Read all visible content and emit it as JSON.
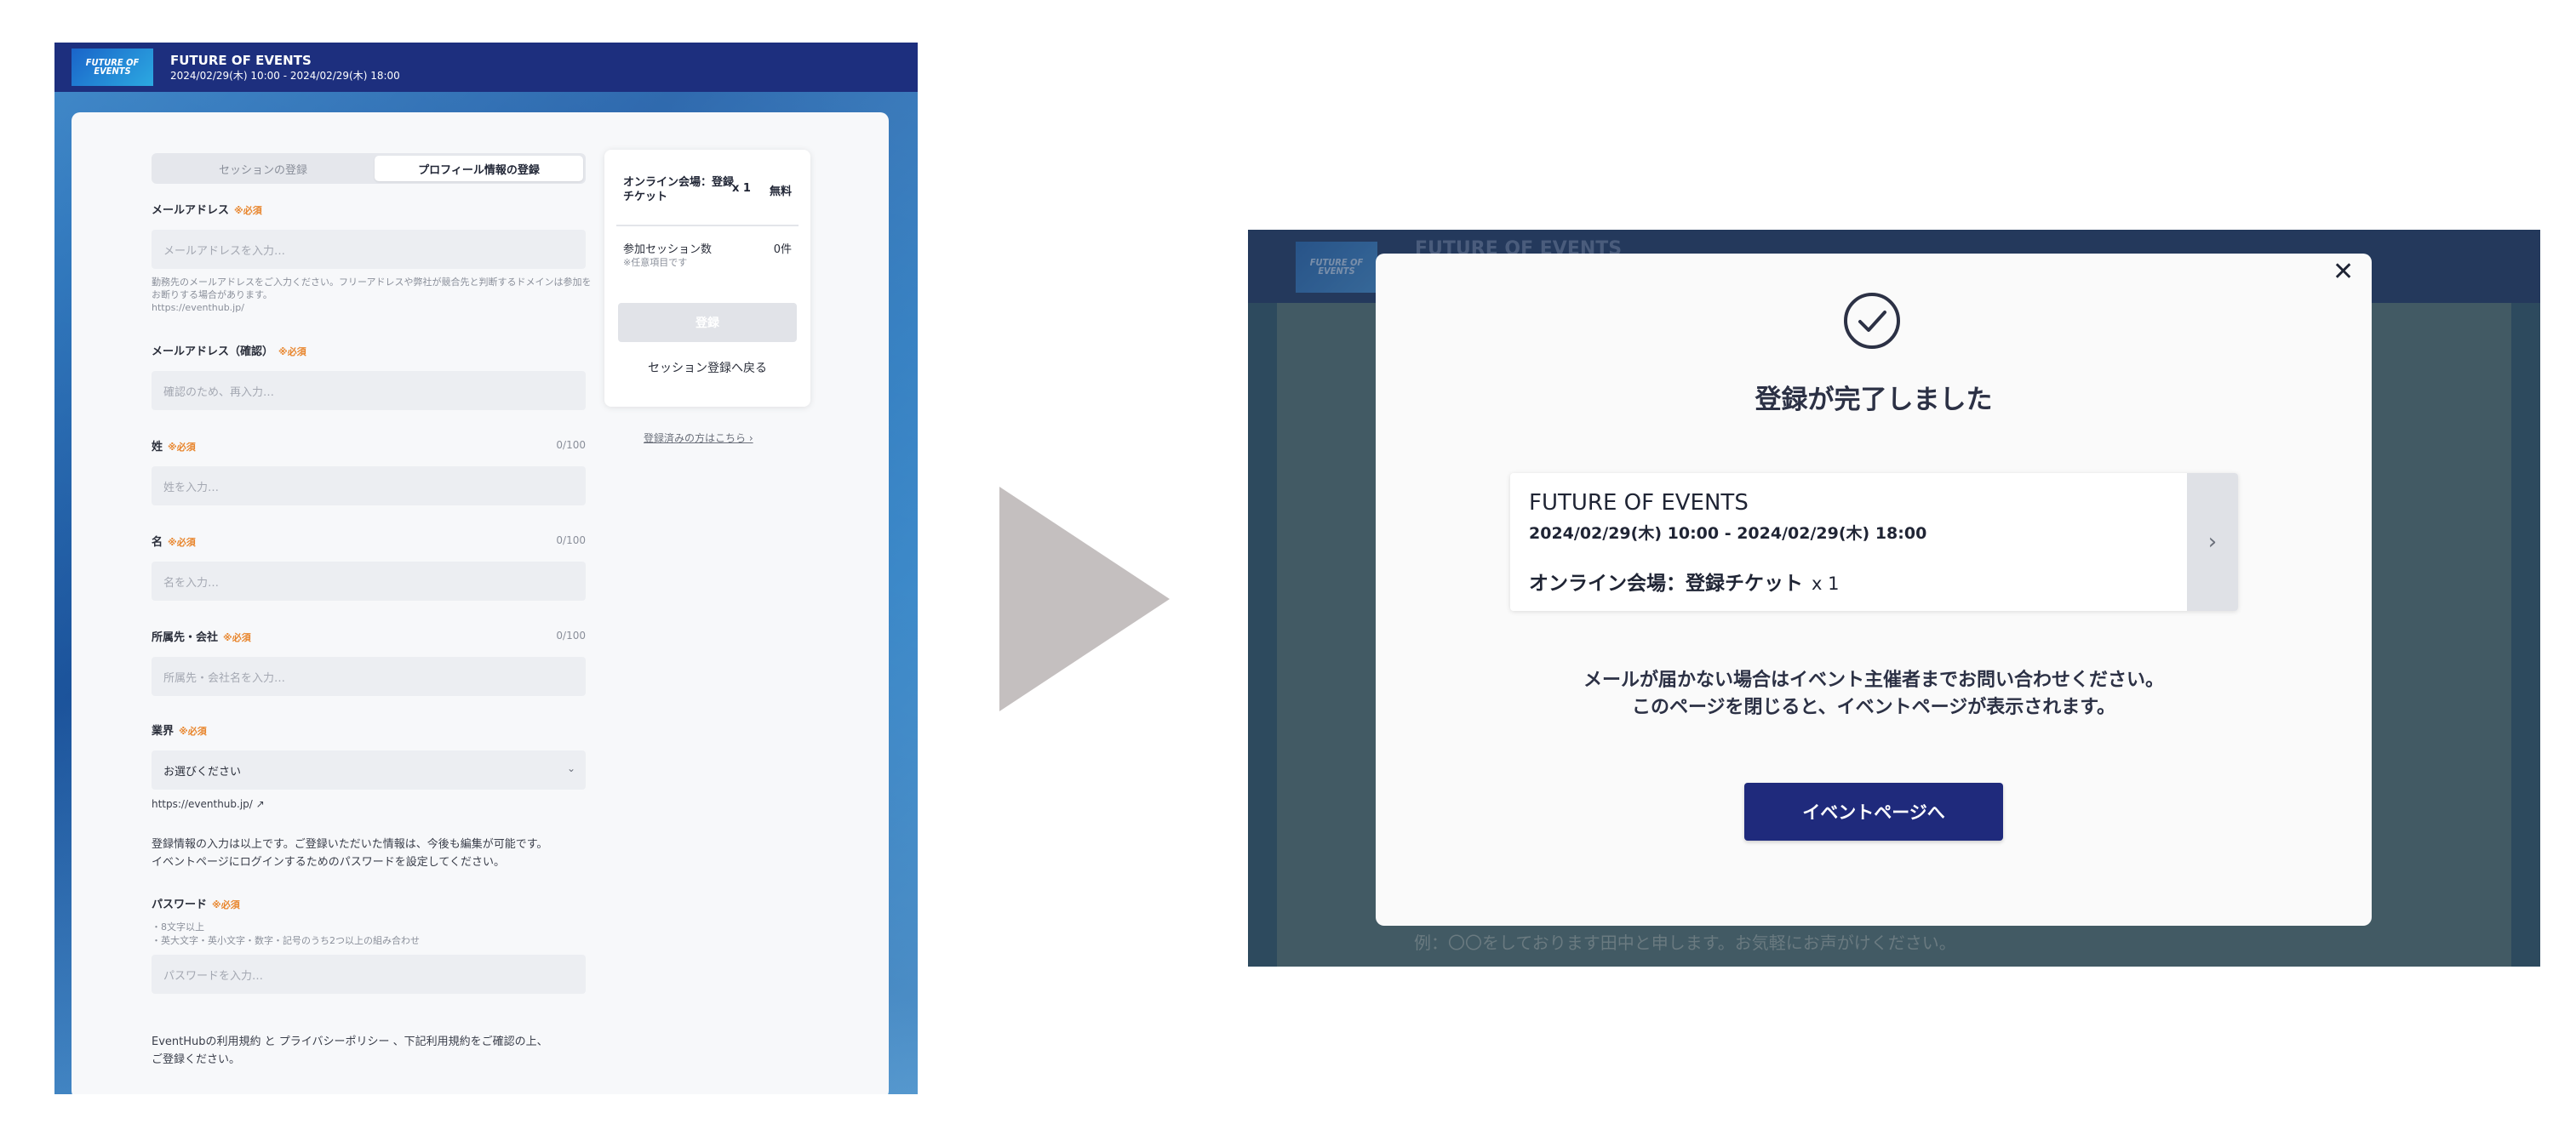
{
  "left": {
    "header": {
      "logo_text": "FUTURE OF EVENTS",
      "event_name": "FUTURE OF EVENTS",
      "event_date": "2024/02/29(木) 10:00 - 2024/02/29(木) 18:00"
    },
    "steps": [
      "セッションの登録",
      "プロフィール情報の登録"
    ],
    "required_mark": "※必須",
    "fields": {
      "email": {
        "label": "メールアドレス",
        "placeholder": "メールアドレスを入力…",
        "note": "勤務先のメールアドレスをご入力ください。フリーアドレスや弊社が競合先と判断するドメインは参加をお断りする場合があります。",
        "note_url": "https://eventhub.jp/"
      },
      "email_confirm": {
        "label": "メールアドレス（確認）",
        "placeholder": "確認のため、再入力…"
      },
      "last_name": {
        "label": "姓",
        "count": "0/100",
        "placeholder": "姓を入力…"
      },
      "first_name": {
        "label": "名",
        "count": "0/100",
        "placeholder": "名を入力…"
      },
      "company": {
        "label": "所属先・会社",
        "count": "0/100",
        "placeholder": "所属先・会社名を入力…"
      },
      "industry": {
        "label": "業界",
        "selected": "お選びください",
        "arrow": "⌄"
      },
      "link": "https://eventhub.jp/",
      "info_text_1": "登録情報の入力は以上です。ご登録いただいた情報は、今後も編集が可能です。",
      "info_text_2": "イベントページにログインするためのパスワードを設定してください。",
      "password": {
        "label": "パスワード",
        "rule_1": "・8文字以上",
        "rule_2": "・英大文字・英小文字・数字・記号のうち2つ以上の組み合わせ",
        "placeholder": "パスワードを入力…"
      },
      "terms_1": "EventHubの利用規約 と プライバシーポリシー 、下記利用規約をご確認の上、",
      "terms_2": "ご登録ください。"
    },
    "sidebar": {
      "ticket_name": "オンライン会場：登録チケット",
      "ticket_qty": "x 1",
      "ticket_price": "無料",
      "session_label": "参加セッション数",
      "session_count": "0件",
      "optional_note": "※任意項目です",
      "register_button": "登録",
      "back_link": "セッション登録へ戻る",
      "login_link": "登録済みの方はこちら ›"
    }
  },
  "right": {
    "background": {
      "logo_text": "FUTURE OF EVENTS",
      "event_name": "FUTURE OF EVENTS",
      "footer_text": "例：〇〇をしております田中と申します。お気軽にお声がけください。"
    },
    "modal": {
      "close": "✕",
      "title": "登録が完了しました",
      "event_name": "FUTURE OF EVENTS",
      "event_date": "2024/02/29(木) 10:00 - 2024/02/29(木) 18:00",
      "ticket_name": "オンライン会場：登録チケット",
      "ticket_qty": "x 1",
      "chevron": "›",
      "message_1": "メールが届かない場合はイベント主催者までお問い合わせください。",
      "message_2": "このページを閉じると、イベントページが表示されます。",
      "button": "イベントページへ"
    }
  },
  "colors": {
    "brand_navy": "#1d2f7e",
    "button_navy": "#1f2a7c",
    "required_orange": "#e8852c",
    "arrow_gray": "#c4bfbf"
  }
}
